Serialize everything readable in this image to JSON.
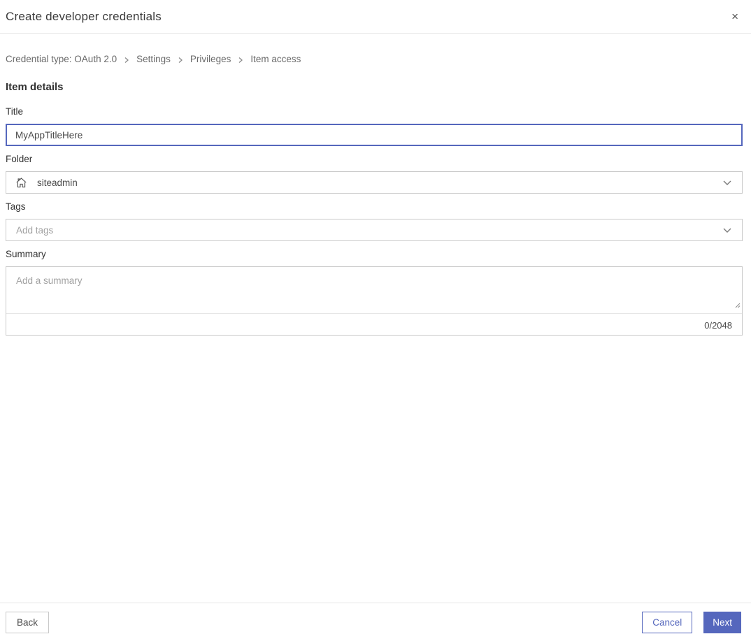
{
  "dialog": {
    "title": "Create developer credentials"
  },
  "icons": {
    "close": "×"
  },
  "breadcrumb": {
    "items": [
      {
        "label": "Credential type: OAuth 2.0"
      },
      {
        "label": "Settings"
      },
      {
        "label": "Privileges"
      },
      {
        "label": "Item access"
      }
    ]
  },
  "section": {
    "heading": "Item details"
  },
  "form": {
    "title": {
      "label": "Title",
      "value": "MyAppTitleHere"
    },
    "folder": {
      "label": "Folder",
      "value": "siteadmin",
      "icon": "home-icon"
    },
    "tags": {
      "label": "Tags",
      "placeholder": "Add tags"
    },
    "summary": {
      "label": "Summary",
      "placeholder": "Add a summary",
      "counter": "0/2048"
    }
  },
  "footer": {
    "back_label": "Back",
    "cancel_label": "Cancel",
    "next_label": "Next"
  },
  "colors": {
    "accent": "#5567bd",
    "border": "#c9c9c9",
    "divider": "#e6e6e6",
    "text": "#323232",
    "muted_text": "#6a6a6a",
    "placeholder": "#a1a1a1"
  }
}
